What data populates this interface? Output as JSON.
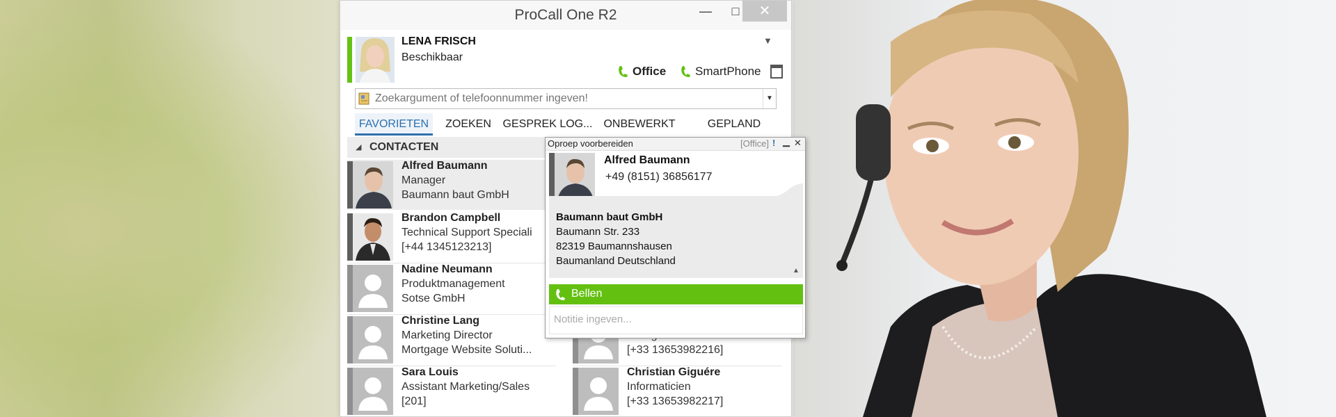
{
  "window": {
    "title": "ProCall One R2",
    "minimize_glyph": "—",
    "maximize_glyph": "□",
    "close_glyph": "✕"
  },
  "user": {
    "name": "LENA FRISCH",
    "status": "Beschikbaar",
    "status_color": "#66c212",
    "devices": [
      {
        "label": "Office",
        "icon": "phone-icon",
        "color": "#63c011"
      },
      {
        "label": "SmartPhone",
        "icon": "phone-icon",
        "color": "#63c011"
      }
    ],
    "calendar_icon": "calendar-icon"
  },
  "search": {
    "placeholder": "Zoekargument of telefoonnummer ingeven!",
    "value": ""
  },
  "tabs": [
    {
      "label": "FAVORIETEN",
      "active": true
    },
    {
      "label": "ZOEKEN",
      "active": false
    },
    {
      "label": "GESPREK LOG...",
      "active": false
    },
    {
      "label": "ONBEWERKT",
      "active": false
    },
    {
      "label": "GEPLAND",
      "active": false
    }
  ],
  "section": {
    "label": "CONTACTEN"
  },
  "contacts_left": [
    {
      "name": "Alfred Baumann",
      "line1": "Manager",
      "line2": "Baumann baut GmbH",
      "photo": "photo"
    },
    {
      "name": "Brandon Campbell",
      "line1": "Technical Support Speciali",
      "line2": "[+44 1345123213]",
      "photo": "photo"
    },
    {
      "name": "Nadine Neumann",
      "line1": "Produktmanagement",
      "line2": "Sotse GmbH",
      "photo": "placeholder"
    },
    {
      "name": "Christine Lang",
      "line1": "Marketing Director",
      "line2": "Mortgage Website Soluti...",
      "photo": "placeholder"
    },
    {
      "name": "Sara Louis",
      "line1": "Assistant Marketing/Sales",
      "line2": "[201]",
      "photo": "placeholder"
    }
  ],
  "contacts_right": [
    {
      "name": "",
      "line1": "Chargée",
      "line2": "[+33 13653982216]",
      "photo": "placeholder"
    },
    {
      "name": "Christian Giguére",
      "line1": "Informaticien",
      "line2": "[+33 13653982217]",
      "photo": "placeholder"
    }
  ],
  "popup": {
    "title": "Oproep voorbereiden",
    "device": "[Office]",
    "pin_glyph": "!",
    "contact_name": "Alfred Baumann",
    "phone": "+49 (8151) 36856177",
    "company": "Baumann baut GmbH",
    "address": [
      "Baumann Str. 233",
      "82319 Baumannshausen",
      "Baumanland Deutschland"
    ],
    "call_label": "Bellen",
    "note_placeholder": "Notitie ingeven..."
  },
  "colors": {
    "accent": "#2e6fae",
    "call_green": "#63c011"
  }
}
